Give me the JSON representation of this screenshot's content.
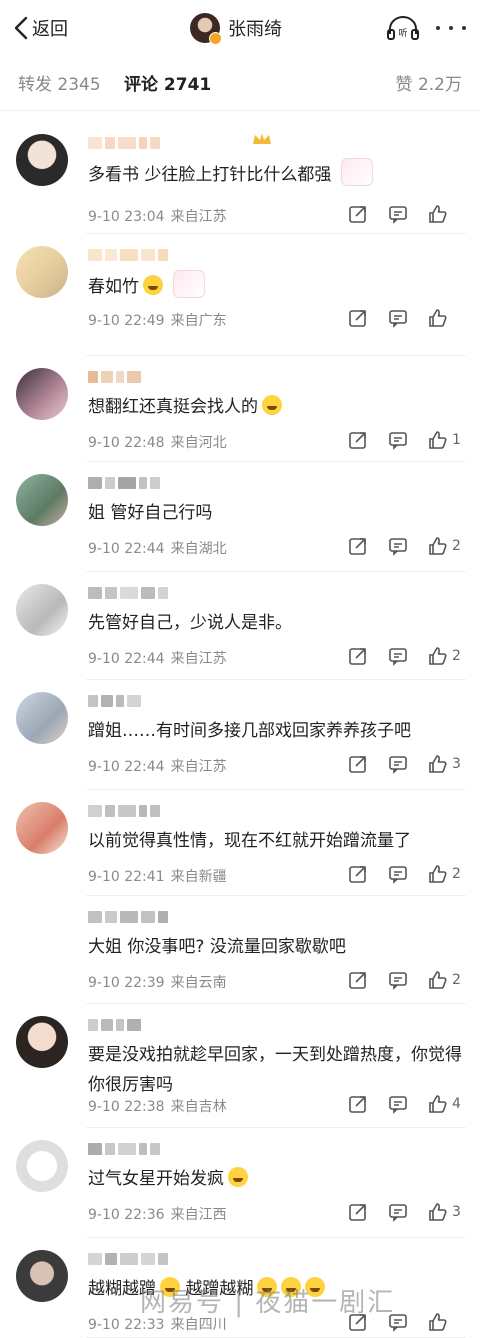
{
  "header": {
    "back_label": "返回",
    "title": "张雨绮"
  },
  "tabs": {
    "repost": "转发 2345",
    "comments": "评论 2741",
    "likes": "赞 2.2万"
  },
  "icons": {
    "back": "chevron-left-icon",
    "listen": "headphones-listen-icon",
    "more": "more-dots-icon",
    "share": "share-icon",
    "reply": "comment-icon",
    "like": "thumbs-up-icon"
  },
  "comments": [
    {
      "text": "多看书 少往脸上打针比什么都强",
      "time": "9-10 23:04",
      "location": "来自江苏",
      "likes": ""
    },
    {
      "text": "春如竹",
      "time": "9-10 22:49",
      "location": "来自广东",
      "likes": ""
    },
    {
      "text": "想翻红还真挺会找人的",
      "time": "9-10 22:48",
      "location": "来自河北",
      "likes": "1"
    },
    {
      "text": "姐 管好自己行吗",
      "time": "9-10 22:44",
      "location": "来自湖北",
      "likes": "2"
    },
    {
      "text": "先管好自己，少说人是非。",
      "time": "9-10 22:44",
      "location": "来自江苏",
      "likes": "2"
    },
    {
      "text": "蹭姐……有时间多接几部戏回家养养孩子吧",
      "time": "9-10 22:44",
      "location": "来自江苏",
      "likes": "3"
    },
    {
      "text": "以前觉得真性情，现在不红就开始蹭流量了",
      "time": "9-10 22:41",
      "location": "来自新疆",
      "likes": "2"
    },
    {
      "text": "大姐 你没事吧? 没流量回家歇歇吧",
      "time": "9-10 22:39",
      "location": "来自云南",
      "likes": "2"
    },
    {
      "text": "要是没戏拍就趁早回家，一天到处蹭热度，你觉得你很厉害吗",
      "time": "9-10 22:38",
      "location": "来自吉林",
      "likes": "4"
    },
    {
      "text": "过气女星开始发疯",
      "time": "9-10 22:36",
      "location": "来自江西",
      "likes": "3"
    },
    {
      "text": "越糊越蹭",
      "text2": "越蹭越糊",
      "time": "9-10 22:33",
      "location": "来自四川",
      "likes": ""
    }
  ],
  "watermark": "网易号 | 夜猫一剧汇"
}
